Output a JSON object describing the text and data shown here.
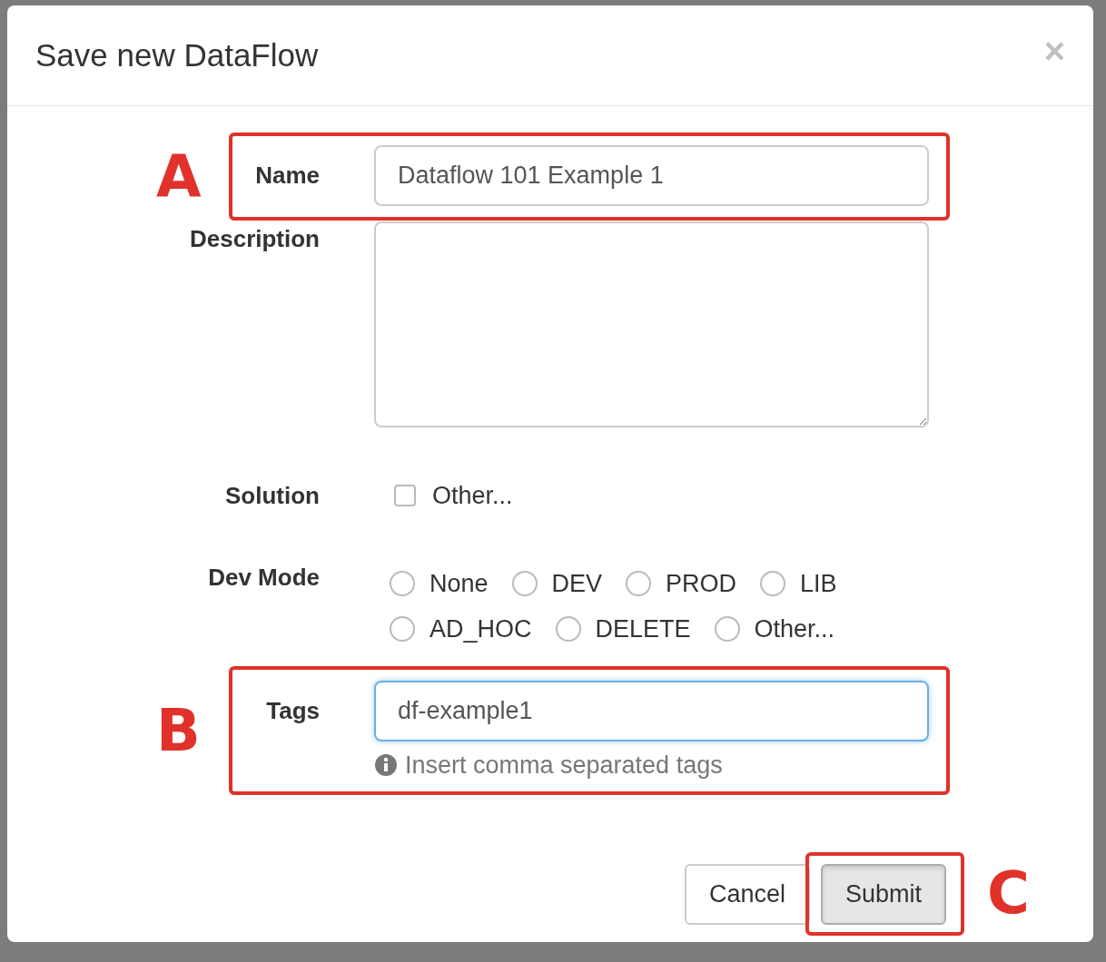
{
  "dialog": {
    "title": "Save new DataFlow",
    "close": "×"
  },
  "name": {
    "label": "Name",
    "value": "Dataflow 101 Example 1",
    "annotation": "A"
  },
  "description": {
    "label": "Description"
  },
  "solution": {
    "label": "Solution",
    "options": [
      {
        "label": "Other...",
        "checked": false
      }
    ]
  },
  "dev_mode": {
    "label": "Dev Mode",
    "options": [
      {
        "label": "None",
        "selected": false
      },
      {
        "label": "DEV",
        "selected": false
      },
      {
        "label": "PROD",
        "selected": false
      },
      {
        "label": "LIB",
        "selected": false
      },
      {
        "label": "AD_HOC",
        "selected": false
      },
      {
        "label": "DELETE",
        "selected": false
      },
      {
        "label": "Other...",
        "selected": false
      }
    ]
  },
  "tags": {
    "label": "Tags",
    "value": "df-example1",
    "focused": true,
    "help": "Insert comma separated tags",
    "annotation": "B"
  },
  "buttons": [
    {
      "label": "Cancel",
      "pressed": false
    },
    {
      "label": "Submit",
      "pressed": true,
      "annotation": "C"
    }
  ]
}
